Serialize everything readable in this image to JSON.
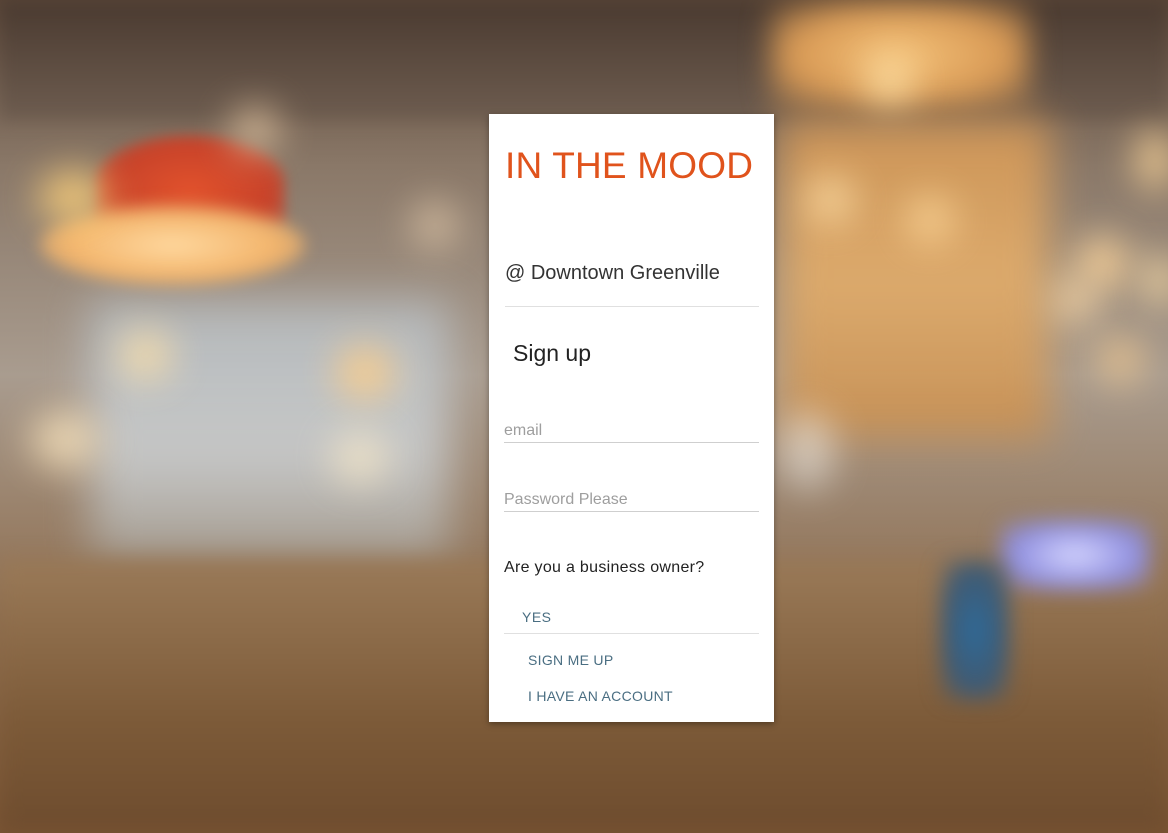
{
  "brand": {
    "title": "IN THE MOOD",
    "color": "#e0531c"
  },
  "location": "@ Downtown Greenville",
  "form": {
    "title": "Sign up",
    "email_placeholder": "email",
    "email_value": "",
    "password_placeholder": "Password Please",
    "password_value": "",
    "question": "Are you a business owner?",
    "yes_label": "YES",
    "signup_label": "SIGN ME UP",
    "account_label": "I HAVE AN ACCOUNT",
    "link_color": "#4a6e82"
  }
}
